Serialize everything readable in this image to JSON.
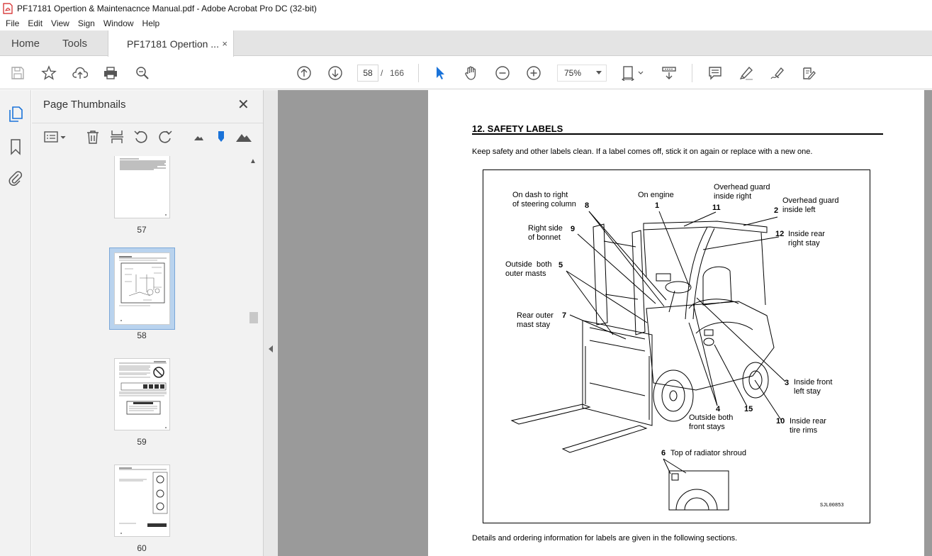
{
  "window": {
    "title": "PF17181 Opertion & Maintenacnce Manual.pdf - Adobe Acrobat Pro DC (32-bit)"
  },
  "menu": {
    "items": [
      "File",
      "Edit",
      "View",
      "Sign",
      "Window",
      "Help"
    ]
  },
  "tabs": {
    "home": "Home",
    "tools": "Tools",
    "doc": "PF17181 Opertion ...",
    "close": "×"
  },
  "toolbar": {
    "page_current": "58",
    "page_sep": "/",
    "page_total": "166",
    "zoom": "75%",
    "icons": [
      "save-icon",
      "star-icon",
      "upload-icon",
      "print-icon",
      "zoom-search-icon",
      "prev-page-icon",
      "next-page-icon",
      "select-arrow-icon",
      "hand-icon",
      "zoom-out-icon",
      "zoom-in-icon",
      "fit-page-icon",
      "scroll-mode-icon",
      "comment-icon",
      "highlight-icon",
      "sign-icon",
      "fill-sign-icon"
    ]
  },
  "panel": {
    "title": "Page Thumbnails",
    "close": "✕",
    "thumbnails": [
      {
        "label": "57",
        "selected": false
      },
      {
        "label": "58",
        "selected": true
      },
      {
        "label": "59",
        "selected": false
      },
      {
        "label": "60",
        "selected": false
      }
    ]
  },
  "document": {
    "heading": "12. SAFETY LABELS",
    "intro": "Keep safety and other labels clean. If a label comes off, stick it on again or replace with a new one.",
    "footer": "Details and ordering information for labels are given in the following sections.",
    "figure": {
      "code": "SJL00853",
      "labels": {
        "l8": "On dash to right\nof steering column",
        "l1": "On engine",
        "l11": "Overhead guard\ninside right",
        "l2": "Overhead guard\ninside left",
        "l9": "Right side\nof bonnet",
        "l12": "Inside rear\nright stay",
        "l5": "Outside  both\nouter masts",
        "l7": "Rear outer\nmast stay",
        "l3": "Inside front\nleft stay",
        "l4": "Outside both\nfront stays",
        "l10": "Inside rear\ntire rims",
        "l6": "Top of radiator shroud"
      },
      "numbers": {
        "n8": "8",
        "n1": "1",
        "n11": "11",
        "n2": "2",
        "n9": "9",
        "n12": "12",
        "n5": "5",
        "n7": "7",
        "n3": "3",
        "n4": "4",
        "n15": "15",
        "n10": "10",
        "n6": "6"
      }
    }
  }
}
